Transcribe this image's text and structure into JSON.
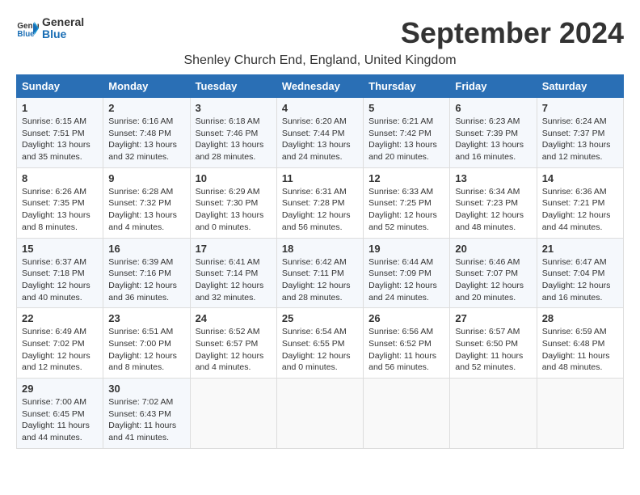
{
  "logo": {
    "line1": "General",
    "line2": "Blue"
  },
  "title": "September 2024",
  "subtitle": "Shenley Church End, England, United Kingdom",
  "days_header": [
    "Sunday",
    "Monday",
    "Tuesday",
    "Wednesday",
    "Thursday",
    "Friday",
    "Saturday"
  ],
  "weeks": [
    [
      {
        "day": "1",
        "info": "Sunrise: 6:15 AM\nSunset: 7:51 PM\nDaylight: 13 hours\nand 35 minutes."
      },
      {
        "day": "2",
        "info": "Sunrise: 6:16 AM\nSunset: 7:48 PM\nDaylight: 13 hours\nand 32 minutes."
      },
      {
        "day": "3",
        "info": "Sunrise: 6:18 AM\nSunset: 7:46 PM\nDaylight: 13 hours\nand 28 minutes."
      },
      {
        "day": "4",
        "info": "Sunrise: 6:20 AM\nSunset: 7:44 PM\nDaylight: 13 hours\nand 24 minutes."
      },
      {
        "day": "5",
        "info": "Sunrise: 6:21 AM\nSunset: 7:42 PM\nDaylight: 13 hours\nand 20 minutes."
      },
      {
        "day": "6",
        "info": "Sunrise: 6:23 AM\nSunset: 7:39 PM\nDaylight: 13 hours\nand 16 minutes."
      },
      {
        "day": "7",
        "info": "Sunrise: 6:24 AM\nSunset: 7:37 PM\nDaylight: 13 hours\nand 12 minutes."
      }
    ],
    [
      {
        "day": "8",
        "info": "Sunrise: 6:26 AM\nSunset: 7:35 PM\nDaylight: 13 hours\nand 8 minutes."
      },
      {
        "day": "9",
        "info": "Sunrise: 6:28 AM\nSunset: 7:32 PM\nDaylight: 13 hours\nand 4 minutes."
      },
      {
        "day": "10",
        "info": "Sunrise: 6:29 AM\nSunset: 7:30 PM\nDaylight: 13 hours\nand 0 minutes."
      },
      {
        "day": "11",
        "info": "Sunrise: 6:31 AM\nSunset: 7:28 PM\nDaylight: 12 hours\nand 56 minutes."
      },
      {
        "day": "12",
        "info": "Sunrise: 6:33 AM\nSunset: 7:25 PM\nDaylight: 12 hours\nand 52 minutes."
      },
      {
        "day": "13",
        "info": "Sunrise: 6:34 AM\nSunset: 7:23 PM\nDaylight: 12 hours\nand 48 minutes."
      },
      {
        "day": "14",
        "info": "Sunrise: 6:36 AM\nSunset: 7:21 PM\nDaylight: 12 hours\nand 44 minutes."
      }
    ],
    [
      {
        "day": "15",
        "info": "Sunrise: 6:37 AM\nSunset: 7:18 PM\nDaylight: 12 hours\nand 40 minutes."
      },
      {
        "day": "16",
        "info": "Sunrise: 6:39 AM\nSunset: 7:16 PM\nDaylight: 12 hours\nand 36 minutes."
      },
      {
        "day": "17",
        "info": "Sunrise: 6:41 AM\nSunset: 7:14 PM\nDaylight: 12 hours\nand 32 minutes."
      },
      {
        "day": "18",
        "info": "Sunrise: 6:42 AM\nSunset: 7:11 PM\nDaylight: 12 hours\nand 28 minutes."
      },
      {
        "day": "19",
        "info": "Sunrise: 6:44 AM\nSunset: 7:09 PM\nDaylight: 12 hours\nand 24 minutes."
      },
      {
        "day": "20",
        "info": "Sunrise: 6:46 AM\nSunset: 7:07 PM\nDaylight: 12 hours\nand 20 minutes."
      },
      {
        "day": "21",
        "info": "Sunrise: 6:47 AM\nSunset: 7:04 PM\nDaylight: 12 hours\nand 16 minutes."
      }
    ],
    [
      {
        "day": "22",
        "info": "Sunrise: 6:49 AM\nSunset: 7:02 PM\nDaylight: 12 hours\nand 12 minutes."
      },
      {
        "day": "23",
        "info": "Sunrise: 6:51 AM\nSunset: 7:00 PM\nDaylight: 12 hours\nand 8 minutes."
      },
      {
        "day": "24",
        "info": "Sunrise: 6:52 AM\nSunset: 6:57 PM\nDaylight: 12 hours\nand 4 minutes."
      },
      {
        "day": "25",
        "info": "Sunrise: 6:54 AM\nSunset: 6:55 PM\nDaylight: 12 hours\nand 0 minutes."
      },
      {
        "day": "26",
        "info": "Sunrise: 6:56 AM\nSunset: 6:52 PM\nDaylight: 11 hours\nand 56 minutes."
      },
      {
        "day": "27",
        "info": "Sunrise: 6:57 AM\nSunset: 6:50 PM\nDaylight: 11 hours\nand 52 minutes."
      },
      {
        "day": "28",
        "info": "Sunrise: 6:59 AM\nSunset: 6:48 PM\nDaylight: 11 hours\nand 48 minutes."
      }
    ],
    [
      {
        "day": "29",
        "info": "Sunrise: 7:00 AM\nSunset: 6:45 PM\nDaylight: 11 hours\nand 44 minutes."
      },
      {
        "day": "30",
        "info": "Sunrise: 7:02 AM\nSunset: 6:43 PM\nDaylight: 11 hours\nand 41 minutes."
      },
      {
        "day": "",
        "info": ""
      },
      {
        "day": "",
        "info": ""
      },
      {
        "day": "",
        "info": ""
      },
      {
        "day": "",
        "info": ""
      },
      {
        "day": "",
        "info": ""
      }
    ]
  ]
}
